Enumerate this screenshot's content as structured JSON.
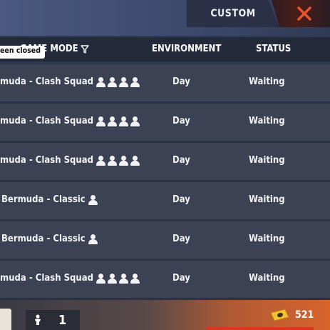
{
  "header": {
    "tab_label": "CUSTOM"
  },
  "columns": {
    "mode": "GAME MODE",
    "environment": "ENVIRONMENT",
    "status": "STATUS"
  },
  "toast": "een closed",
  "rooms": [
    {
      "mode": "muda - Clash Squad",
      "players": 4,
      "environment": "Day",
      "status": "Waiting"
    },
    {
      "mode": "muda - Clash Squad",
      "players": 4,
      "environment": "Day",
      "status": "Waiting"
    },
    {
      "mode": "muda - Clash Squad",
      "players": 4,
      "environment": "Day",
      "status": "Waiting"
    },
    {
      "mode": "Bermuda - Classic",
      "players": 1,
      "environment": "Day",
      "status": "Waiting"
    },
    {
      "mode": "Bermuda - Classic",
      "players": 1,
      "environment": "Day",
      "status": "Waiting"
    },
    {
      "mode": "muda - Clash Squad",
      "players": 4,
      "environment": "Day",
      "status": "Waiting"
    }
  ],
  "footer": {
    "room_count": "1",
    "coins": "521"
  },
  "colors": {
    "close_x": "#e8552c",
    "accent_orange": "#d8642c"
  },
  "icons": {
    "close": "close-icon",
    "filter": "filter-icon",
    "player": "player-icon",
    "coin": "coin-ticket-icon",
    "character": "character-icon"
  }
}
